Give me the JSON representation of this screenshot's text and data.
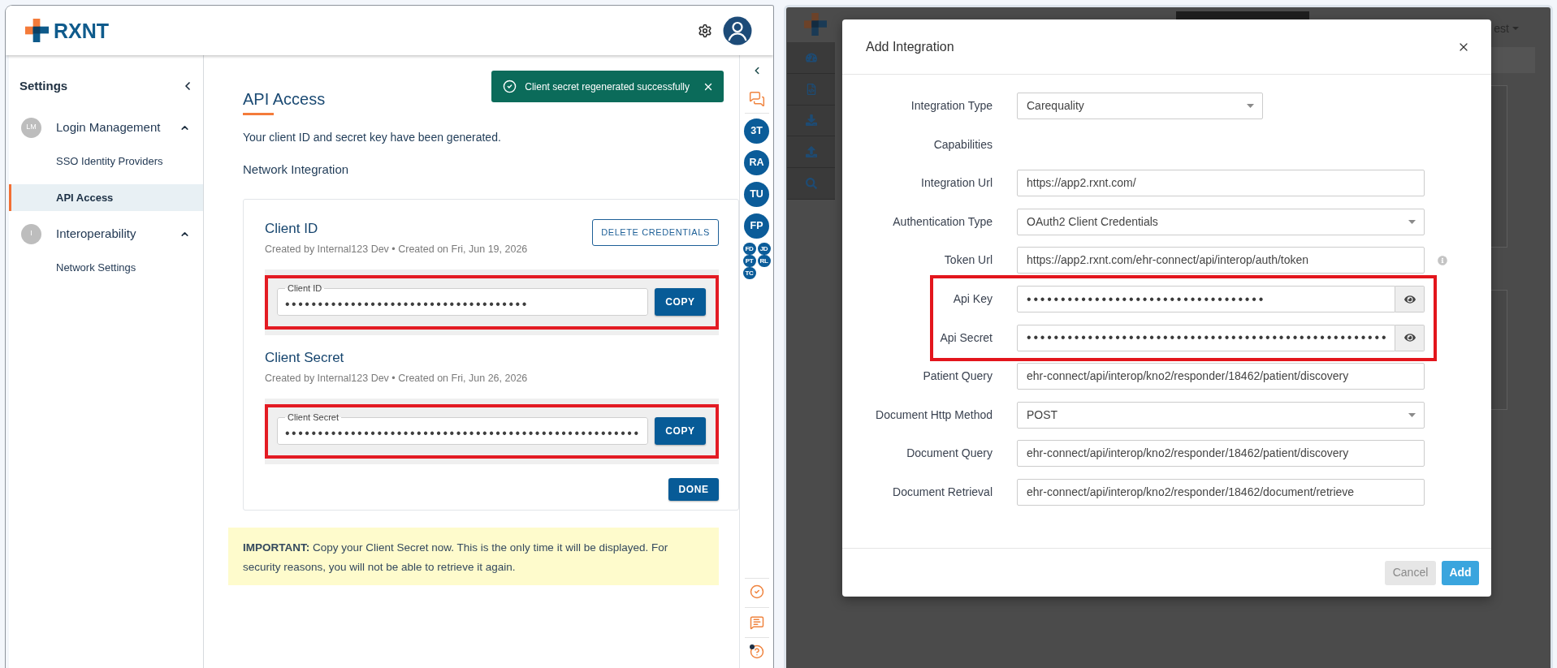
{
  "left_app": {
    "logo": "RXNT",
    "sidebar": {
      "title": "Settings",
      "groups": [
        {
          "badge": "LM",
          "label": "Login Management",
          "expanded": true,
          "children": [
            {
              "label": "SSO Identity Providers",
              "selected": false
            },
            {
              "label": "API Access",
              "selected": true
            }
          ]
        },
        {
          "badge": "I",
          "label": "Interoperability",
          "expanded": true,
          "children": [
            {
              "label": "Network Settings",
              "selected": false
            }
          ]
        }
      ]
    },
    "toast": {
      "message": "Client secret regenerated successfully"
    },
    "page": {
      "title": "API Access",
      "intro": "Your client ID and secret key have been generated.",
      "section": "Network Integration"
    },
    "credentials": {
      "items": [
        {
          "title": "Client ID",
          "meta": "Created by Internal123 Dev • Created on Fri, Jun 19, 2026",
          "action": "DELETE CREDENTIALS",
          "field_label": "Client ID",
          "value": "•••••••••••••••••••••••••••••••••••••",
          "button": "COPY",
          "highlighted": true
        },
        {
          "title": "Client Secret",
          "meta": "Created by Internal123 Dev • Created on Fri, Jun 26, 2026",
          "field_label": "Client Secret",
          "value": "••••••••••••••••••••••••••••••••••••••••••••••••••••••",
          "button": "COPY",
          "highlighted": true
        }
      ],
      "done_button": "DONE"
    },
    "notice": "**IMPORTANT:** Copy your Client Secret now. This is the only time it will be displayed. For security reasons, you will not be able to retrieve it again.",
    "rail": {
      "avatars": [
        "3T",
        "RA",
        "TU",
        "FP"
      ],
      "small_avatars": [
        "FD",
        "JD",
        "PT",
        "RL",
        "TC"
      ]
    }
  },
  "right_app": {
    "user_menu": "est",
    "modal": {
      "title": "Add Integration",
      "fields": [
        {
          "kind": "select",
          "label": "Integration Type",
          "value": "Carequality",
          "highlighted": false
        },
        {
          "kind": "heading",
          "label": "Capabilities",
          "highlighted": false
        },
        {
          "kind": "text",
          "label": "Integration Url",
          "value": "https://app2.rxnt.com/",
          "highlighted": false
        },
        {
          "kind": "select",
          "label": "Authentication Type",
          "value": "OAuth2 Client Credentials",
          "highlighted": false
        },
        {
          "kind": "text",
          "label": "Token Url",
          "value": "https://app2.rxnt.com/ehr-connect/api/interop/auth/token",
          "info": true,
          "highlighted": false
        },
        {
          "kind": "secret",
          "label": "Api Key",
          "value": "•••••••••••••••••••••••••••••••••••",
          "highlighted": true
        },
        {
          "kind": "secret",
          "label": "Api Secret",
          "value": "•••••••••••••••••••••••••••••••••••••••••••••••••••••",
          "highlighted": true
        },
        {
          "kind": "text",
          "label": "Patient Query",
          "value": "ehr-connect/api/interop/kno2/responder/18462/patient/discovery",
          "highlighted": false
        },
        {
          "kind": "select",
          "label": "Document Http Method",
          "value": "POST",
          "highlighted": false
        },
        {
          "kind": "text",
          "label": "Document Query",
          "value": "ehr-connect/api/interop/kno2/responder/18462/patient/discovery",
          "highlighted": false
        },
        {
          "kind": "text",
          "label": "Document Retrieval",
          "value": "ehr-connect/api/interop/kno2/responder/18462/document/retrieve",
          "highlighted": false
        }
      ],
      "buttons": [
        {
          "label": "Cancel",
          "kind": "secondary"
        },
        {
          "label": "Add",
          "kind": "primary"
        }
      ]
    }
  }
}
